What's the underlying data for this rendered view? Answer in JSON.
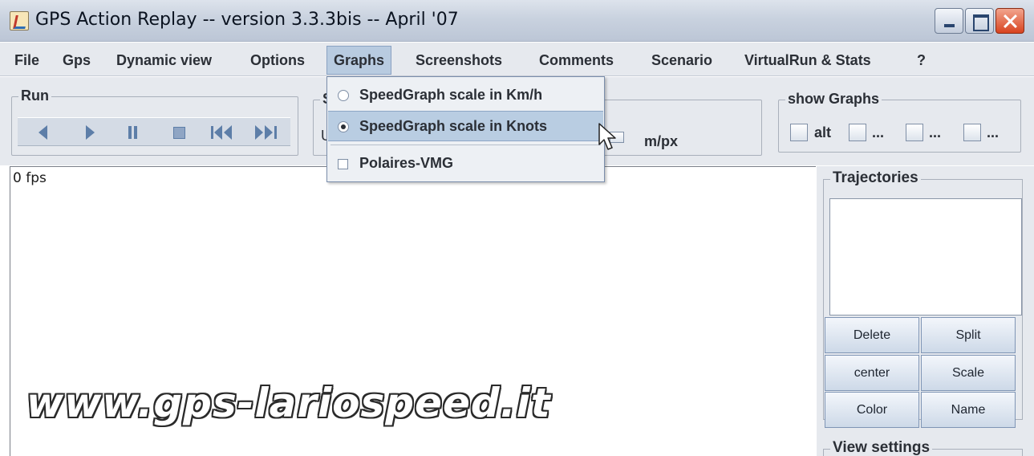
{
  "window": {
    "title": "GPS Action Replay -- version 3.3.3bis -- April '07"
  },
  "menu": {
    "items": [
      "File",
      "Gps",
      "Dynamic view",
      "Options",
      "Graphs",
      "Screenshots",
      "Comments",
      "Scenario",
      "VirtualRun & Stats",
      "?"
    ],
    "active": "Graphs"
  },
  "graphs_menu": {
    "items": [
      {
        "label": "SpeedGraph scale in Km/h",
        "kind": "radio",
        "checked": false
      },
      {
        "label": "SpeedGraph scale in Knots",
        "kind": "radio",
        "checked": true
      },
      {
        "label": "Polaires-VMG",
        "kind": "checkbox",
        "checked": false
      }
    ]
  },
  "toolbar": {
    "run_title": "Run",
    "scale_unit": "m/px",
    "show_graphs_title": "show Graphs",
    "show_graphs": [
      "alt",
      "...",
      "...",
      "..."
    ],
    "partial_title": "S",
    "partial_label": "U"
  },
  "canvas": {
    "fps": "0 fps",
    "watermark": "www.gps-lariospeed.it"
  },
  "trajectories": {
    "title": "Trajectories",
    "buttons": [
      "Delete",
      "Split",
      "center",
      "Scale",
      "Color",
      "Name"
    ]
  },
  "view_settings": {
    "title": "View settings"
  },
  "icons": {
    "app": "java-cup-icon",
    "cursor": "mouse-pointer-icon"
  }
}
